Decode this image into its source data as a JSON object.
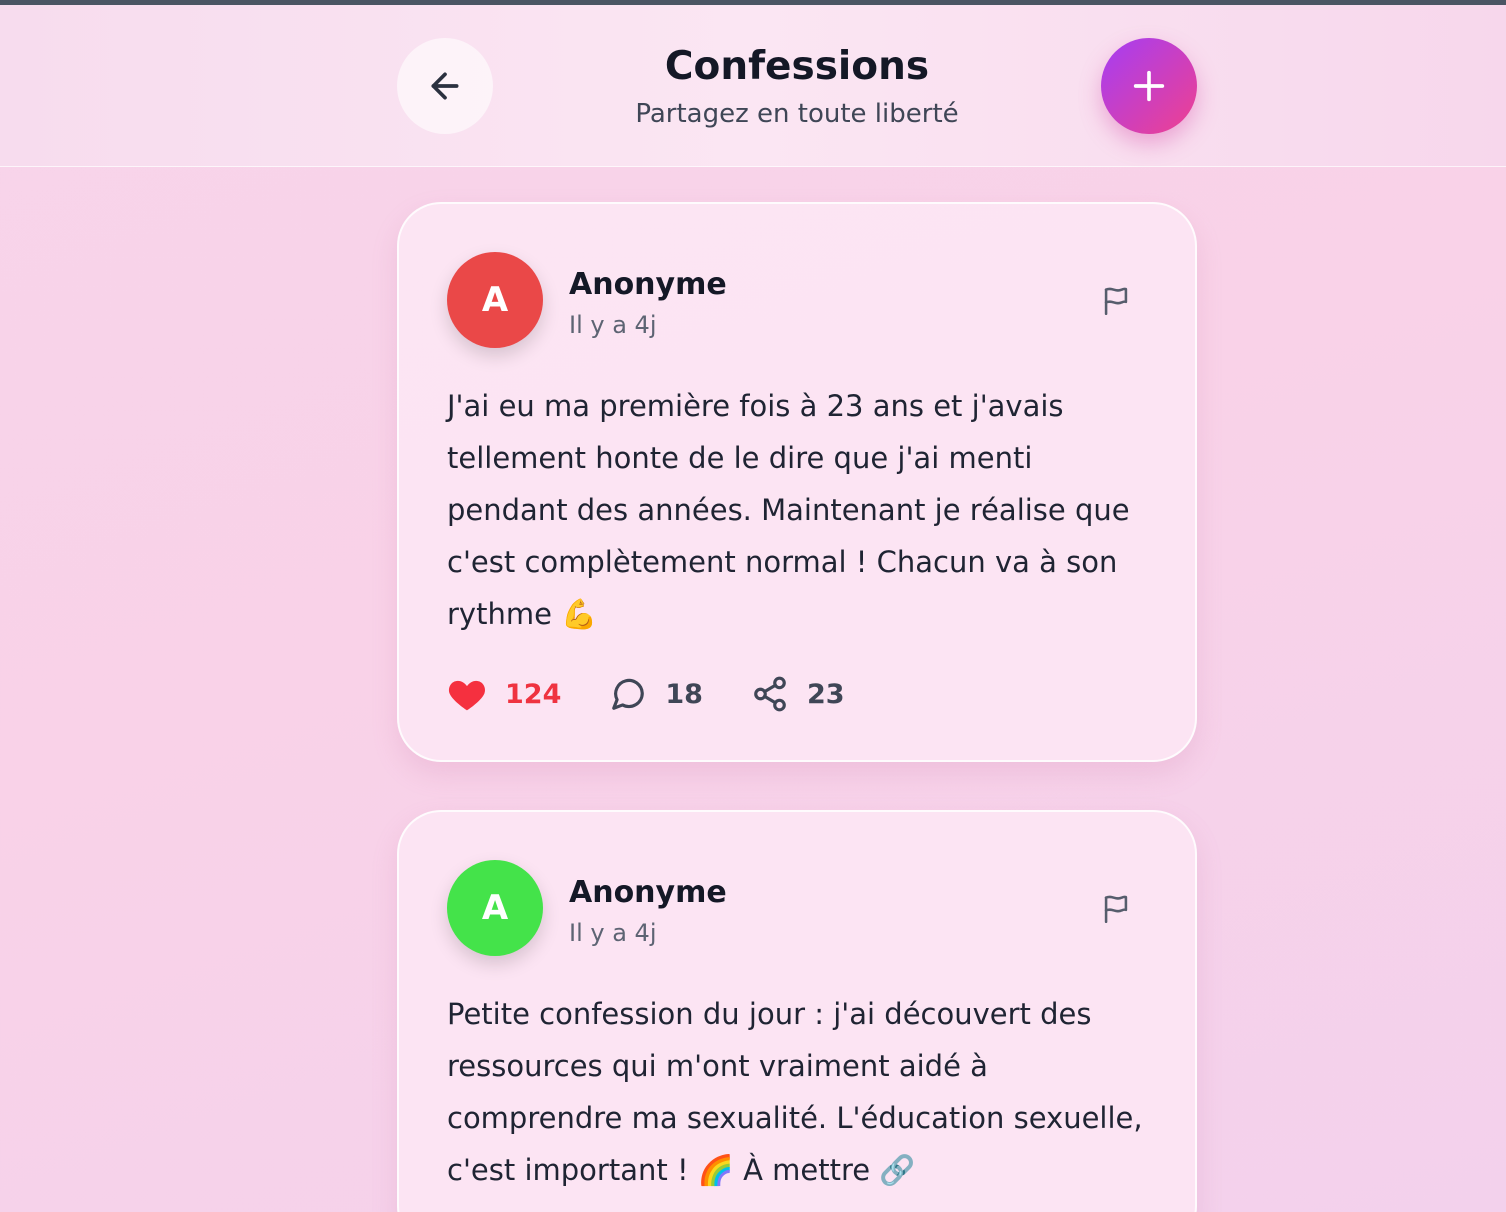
{
  "header": {
    "title": "Confessions",
    "subtitle": "Partagez en toute liberté"
  },
  "colors": {
    "accent_gradient_start": "#a43ef5",
    "accent_gradient_end": "#f0408e",
    "like_color": "#ef3340"
  },
  "posts": [
    {
      "avatar_letter": "A",
      "avatar_color": "#ea4848",
      "author": "Anonyme",
      "time": "Il y a 4j",
      "content": "J'ai eu ma première fois à 23 ans et j'avais tellement honte de le dire que j'ai menti pendant des années. Maintenant je réalise que c'est complètement normal ! Chacun va à son rythme 💪",
      "likes": "124",
      "comments": "18",
      "shares": "23",
      "liked": true
    },
    {
      "avatar_letter": "A",
      "avatar_color": "#44e34a",
      "author": "Anonyme",
      "time": "Il y a 4j",
      "content": "Petite confession du jour : j'ai découvert des ressources qui m'ont vraiment aidé à comprendre ma sexualité. L'éducation sexuelle, c'est important ! 🌈 À mettre 🔗"
    }
  ]
}
